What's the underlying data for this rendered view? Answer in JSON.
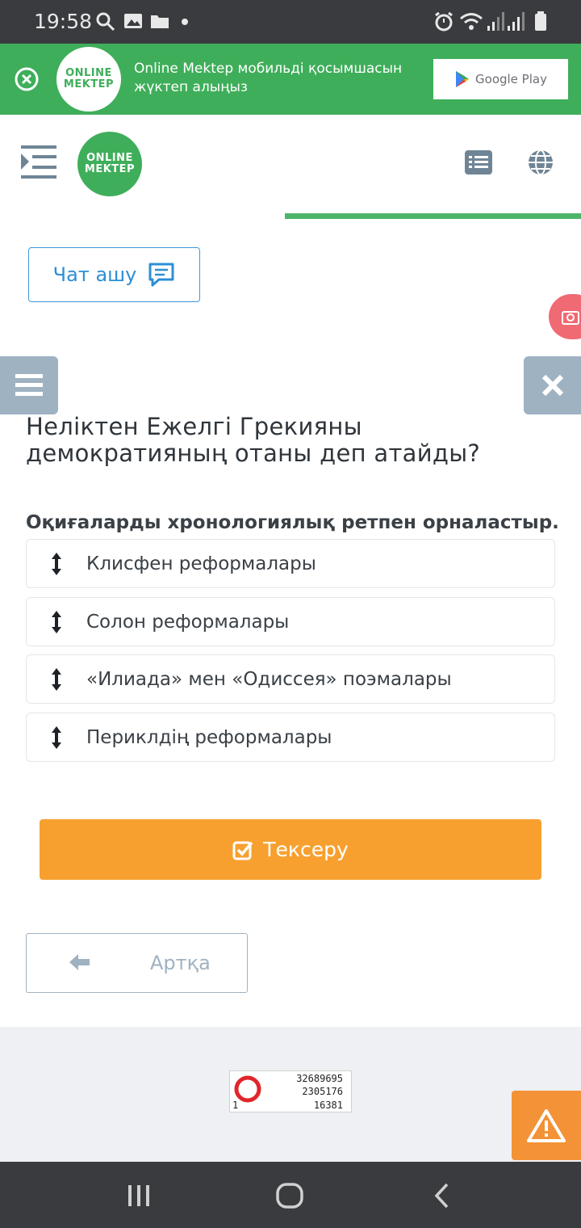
{
  "status_bar": {
    "time": "19:58"
  },
  "banner": {
    "logo_line1": "ONLINE",
    "logo_line2": "MEKTEP",
    "text": "Online Mektep мобильді қосымшасын жүктеп алыңыз",
    "store_button": "Google Play"
  },
  "header": {
    "logo_line1": "ONLINE",
    "logo_line2": "MEKTEP",
    "progress": 0.51
  },
  "chat_button": {
    "label": "Чат ашу"
  },
  "question": {
    "title": "Неліктен Ежелгі Грекияны демократияның отаны деп атайды?",
    "instruction": "Оқиғаларды хронологиялық ретпен орналастыр.",
    "items": [
      {
        "label": "Клисфен реформалары"
      },
      {
        "label": "Солон реформалары"
      },
      {
        "label": "«Илиада» мен «Одиссея» поэмалары"
      },
      {
        "label": "Периклдің реформалары"
      }
    ]
  },
  "actions": {
    "check_label": "Тексеру",
    "back_label": "Артқа"
  },
  "counter": {
    "top": "32689695",
    "middle": "2305176",
    "left": "1",
    "bottom": "16381"
  },
  "colors": {
    "brand_green": "#3fae5a",
    "accent_orange": "#f7a030",
    "link_blue": "#2c8fd6",
    "muted_blue": "#9fb2c2"
  }
}
